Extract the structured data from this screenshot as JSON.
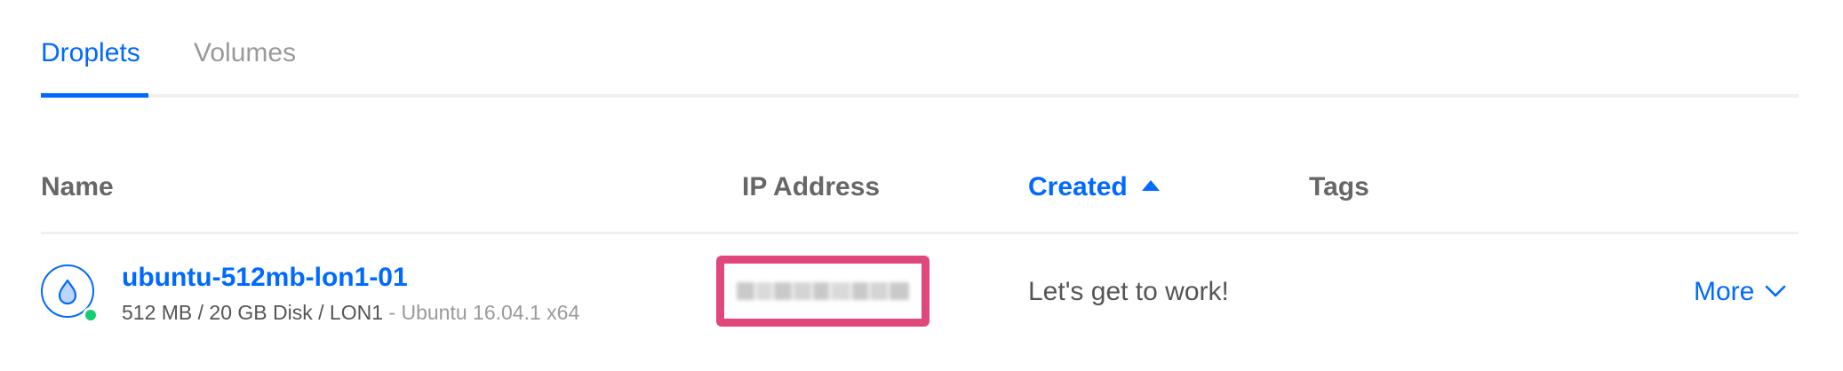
{
  "tabs": [
    {
      "label": "Droplets",
      "active": true
    },
    {
      "label": "Volumes",
      "active": false
    }
  ],
  "table": {
    "columns": {
      "name": "Name",
      "ip": "IP Address",
      "created": "Created",
      "tags": "Tags"
    },
    "sort": {
      "column": "created",
      "direction": "ascending",
      "icon": "sort-ascending-icon"
    },
    "rows": [
      {
        "name": "ubuntu-512mb-lon1-01",
        "specs": "512 MB / 20 GB Disk / LON1",
        "separator": " - ",
        "image": "Ubuntu 16.04.1 x64",
        "status": "active",
        "ip_redacted": true,
        "created": "Let's get to work!",
        "more_label": "More"
      }
    ]
  },
  "colors": {
    "accent": "#0069ff",
    "status_active": "#15cd72",
    "highlight_border": "#e0487d"
  }
}
